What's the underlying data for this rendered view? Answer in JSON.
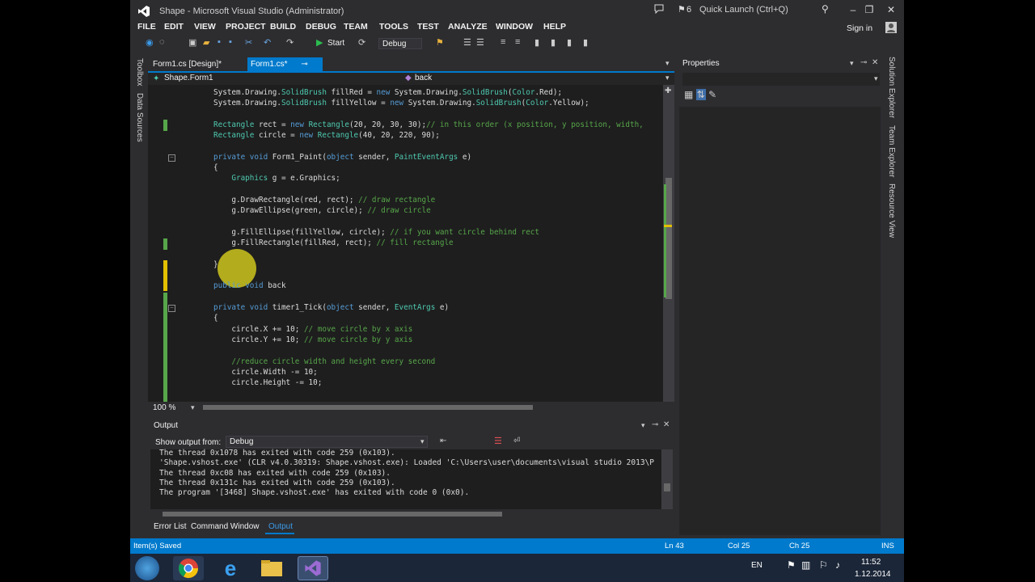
{
  "window": {
    "title": "Shape - Microsoft Visual Studio (Administrator)",
    "notifications": "6",
    "quick_launch_placeholder": "Quick Launch (Ctrl+Q)",
    "sign_in": "Sign in"
  },
  "menu": [
    "FILE",
    "EDIT",
    "VIEW",
    "PROJECT",
    "BUILD",
    "DEBUG",
    "TEAM",
    "TOOLS",
    "TEST",
    "ANALYZE",
    "WINDOW",
    "HELP"
  ],
  "toolbar": {
    "start_label": "Start",
    "config_value": "Debug"
  },
  "left_strip": {
    "toolbox": "Toolbox",
    "data_sources": "Data Sources"
  },
  "tabs": [
    {
      "label": "Form1.cs [Design]*"
    },
    {
      "label": "Form1.cs*"
    }
  ],
  "nav": {
    "class": "Shape.Form1",
    "member": "back"
  },
  "zoom": "100 %",
  "properties": {
    "title": "Properties"
  },
  "right_strip": {
    "solution_explorer": "Solution Explorer",
    "team_explorer": "Team Explorer",
    "resource_view": "Resource View"
  },
  "output": {
    "title": "Output",
    "show_from_label": "Show output from:",
    "source": "Debug",
    "lines": [
      "The thread 0x1078 has exited with code 259 (0x103).",
      "'Shape.vshost.exe' (CLR v4.0.30319: Shape.vshost.exe): Loaded 'C:\\Users\\user\\documents\\visual studio 2013\\P",
      "The thread 0xc08 has exited with code 259 (0x103).",
      "The thread 0x131c has exited with code 259 (0x103).",
      "The program '[3468] Shape.vshost.exe' has exited with code 0 (0x0)."
    ]
  },
  "bottom_tabs": [
    "Error List",
    "Command Window",
    "Output"
  ],
  "status": {
    "message": "Item(s) Saved",
    "ln": "Ln 43",
    "col": "Col 25",
    "ch": "Ch 25",
    "ins": "INS"
  },
  "taskbar": {
    "lang": "EN",
    "time": "11:52",
    "date": "1.12.2014"
  },
  "colors": {
    "accent": "#007acc",
    "background": "#2d2d30",
    "editor": "#1e1e1e",
    "keyword": "#569cd6",
    "type": "#4ec9b0",
    "comment": "#57a64a"
  }
}
